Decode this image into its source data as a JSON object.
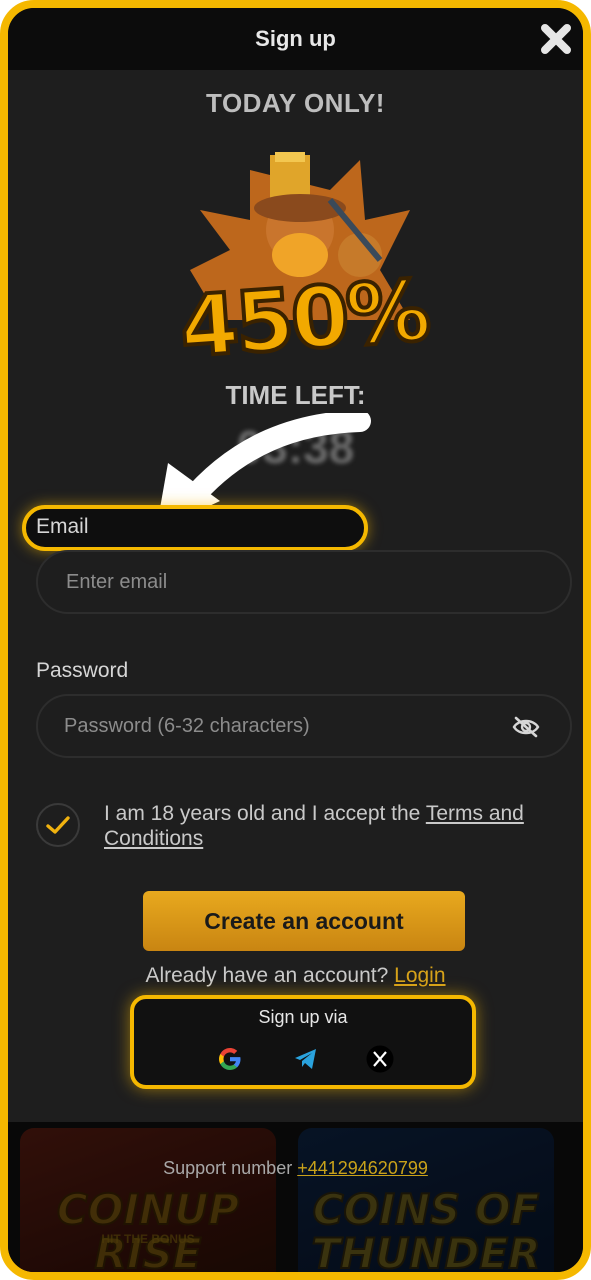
{
  "header": {
    "title": "Sign up"
  },
  "promo": {
    "title": "TODAY ONLY!",
    "bonus_text": "450%",
    "time_left_label": "TIME LEFT:",
    "timer_value": "03:38"
  },
  "form": {
    "email": {
      "label": "Email",
      "placeholder": "Enter email"
    },
    "password": {
      "label": "Password",
      "placeholder": "Password (6-32 characters)"
    },
    "terms": {
      "text": "I am 18 years old and I accept the ",
      "link": "Terms and Conditions",
      "checked": true
    },
    "create_button": "Create an account",
    "already_text": "Already have an account?",
    "login_link": "Login"
  },
  "signup_via": {
    "title": "Sign up via",
    "providers": [
      "google-icon",
      "telegram-icon",
      "x-icon"
    ]
  },
  "footer": {
    "games": [
      {
        "name": "COINUP RISE",
        "tagline": "HIT THE BONUS"
      },
      {
        "name": "COINS OF THUNDER"
      }
    ],
    "support_label": "Support number",
    "support_number": "+441294620799"
  },
  "colors": {
    "accent": "#f5b800",
    "button": "#e0a01a",
    "background": "#1e1e1e"
  }
}
